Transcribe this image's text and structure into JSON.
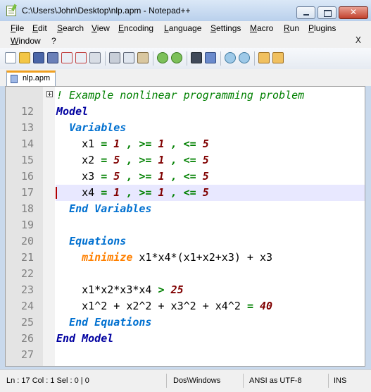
{
  "window": {
    "title": "C:\\Users\\John\\Desktop\\nlp.apm - Notepad++"
  },
  "menu": {
    "items": [
      "File",
      "Edit",
      "Search",
      "View",
      "Encoding",
      "Language",
      "Settings",
      "Macro",
      "Run",
      "Plugins",
      "Window",
      "?"
    ],
    "close_label": "X"
  },
  "toolbar": {
    "icons": [
      "new-file-icon",
      "open-file-icon",
      "save-icon",
      "save-all-icon",
      "close-icon",
      "close-all-icon",
      "print-icon",
      "cut-icon",
      "copy-icon",
      "paste-icon",
      "undo-icon",
      "redo-icon",
      "find-icon",
      "replace-icon",
      "zoom-in-icon",
      "zoom-out-icon",
      "sync-vertical-icon",
      "sync-horizontal-icon"
    ]
  },
  "tabs": [
    {
      "label": "nlp.apm",
      "active": true
    }
  ],
  "editor": {
    "current_line": 17,
    "lines": [
      {
        "num": "",
        "tokens": [
          {
            "t": "! Example nonlinear programming problem",
            "c": "comment"
          }
        ]
      },
      {
        "num": "12",
        "tokens": [
          {
            "t": "Model",
            "c": "kw1"
          }
        ]
      },
      {
        "num": "13",
        "tokens": [
          {
            "t": "  ",
            "c": "t"
          },
          {
            "t": "Variables",
            "c": "kw2"
          }
        ]
      },
      {
        "num": "14",
        "tokens": [
          {
            "t": "    x1 ",
            "c": "t"
          },
          {
            "t": "=",
            "c": "op"
          },
          {
            "t": " ",
            "c": "t"
          },
          {
            "t": "1",
            "c": "n"
          },
          {
            "t": " , ",
            "c": "op"
          },
          {
            "t": ">=",
            "c": "op"
          },
          {
            "t": " ",
            "c": "t"
          },
          {
            "t": "1",
            "c": "n"
          },
          {
            "t": " , ",
            "c": "op"
          },
          {
            "t": "<=",
            "c": "op"
          },
          {
            "t": " ",
            "c": "t"
          },
          {
            "t": "5",
            "c": "n"
          }
        ]
      },
      {
        "num": "15",
        "tokens": [
          {
            "t": "    x2 ",
            "c": "t"
          },
          {
            "t": "=",
            "c": "op"
          },
          {
            "t": " ",
            "c": "t"
          },
          {
            "t": "5",
            "c": "n"
          },
          {
            "t": " , ",
            "c": "op"
          },
          {
            "t": ">=",
            "c": "op"
          },
          {
            "t": " ",
            "c": "t"
          },
          {
            "t": "1",
            "c": "n"
          },
          {
            "t": " , ",
            "c": "op"
          },
          {
            "t": "<=",
            "c": "op"
          },
          {
            "t": " ",
            "c": "t"
          },
          {
            "t": "5",
            "c": "n"
          }
        ]
      },
      {
        "num": "16",
        "tokens": [
          {
            "t": "    x3 ",
            "c": "t"
          },
          {
            "t": "=",
            "c": "op"
          },
          {
            "t": " ",
            "c": "t"
          },
          {
            "t": "5",
            "c": "n"
          },
          {
            "t": " , ",
            "c": "op"
          },
          {
            "t": ">=",
            "c": "op"
          },
          {
            "t": " ",
            "c": "t"
          },
          {
            "t": "1",
            "c": "n"
          },
          {
            "t": " , ",
            "c": "op"
          },
          {
            "t": "<=",
            "c": "op"
          },
          {
            "t": " ",
            "c": "t"
          },
          {
            "t": "5",
            "c": "n"
          }
        ]
      },
      {
        "num": "17",
        "tokens": [
          {
            "t": "    x4 ",
            "c": "t"
          },
          {
            "t": "=",
            "c": "op"
          },
          {
            "t": " ",
            "c": "t"
          },
          {
            "t": "1",
            "c": "n"
          },
          {
            "t": " , ",
            "c": "op"
          },
          {
            "t": ">=",
            "c": "op"
          },
          {
            "t": " ",
            "c": "t"
          },
          {
            "t": "1",
            "c": "n"
          },
          {
            "t": " , ",
            "c": "op"
          },
          {
            "t": "<=",
            "c": "op"
          },
          {
            "t": " ",
            "c": "t"
          },
          {
            "t": "5",
            "c": "n"
          }
        ]
      },
      {
        "num": "18",
        "tokens": [
          {
            "t": "  ",
            "c": "t"
          },
          {
            "t": "End Variables",
            "c": "kw2"
          }
        ]
      },
      {
        "num": "19",
        "tokens": []
      },
      {
        "num": "20",
        "tokens": [
          {
            "t": "  ",
            "c": "t"
          },
          {
            "t": "Equations",
            "c": "kw2"
          }
        ]
      },
      {
        "num": "21",
        "tokens": [
          {
            "t": "    ",
            "c": "t"
          },
          {
            "t": "minimize",
            "c": "kw3"
          },
          {
            "t": " x1*x4*(x1+x2+x3) + x3",
            "c": "t"
          }
        ]
      },
      {
        "num": "22",
        "tokens": []
      },
      {
        "num": "23",
        "tokens": [
          {
            "t": "    x1*x2*x3*x4 ",
            "c": "t"
          },
          {
            "t": ">",
            "c": "op"
          },
          {
            "t": " ",
            "c": "t"
          },
          {
            "t": "25",
            "c": "n"
          }
        ]
      },
      {
        "num": "24",
        "tokens": [
          {
            "t": "    x1^2 + x2^2 + x3^2 + x4^2 ",
            "c": "t"
          },
          {
            "t": "=",
            "c": "op"
          },
          {
            "t": " ",
            "c": "t"
          },
          {
            "t": "40",
            "c": "n"
          }
        ]
      },
      {
        "num": "25",
        "tokens": [
          {
            "t": "  ",
            "c": "t"
          },
          {
            "t": "End Equations",
            "c": "kw2"
          }
        ]
      },
      {
        "num": "26",
        "tokens": [
          {
            "t": "End ",
            "c": "kw1"
          },
          {
            "t": "Model",
            "c": "kw1"
          }
        ]
      },
      {
        "num": "27",
        "tokens": []
      }
    ]
  },
  "status": {
    "ln_col": "Ln : 17    Col : 1    Sel : 0 | 0",
    "eol": "Dos\\Windows",
    "encoding": "ANSI as UTF-8",
    "mode": "INS"
  },
  "colors": {
    "comment": "#008000",
    "keyword": "#0000a0",
    "section": "#0070d0",
    "objective": "#ff8000",
    "operator": "#008000",
    "number": "#800000",
    "current_line": "#e8e8ff"
  }
}
